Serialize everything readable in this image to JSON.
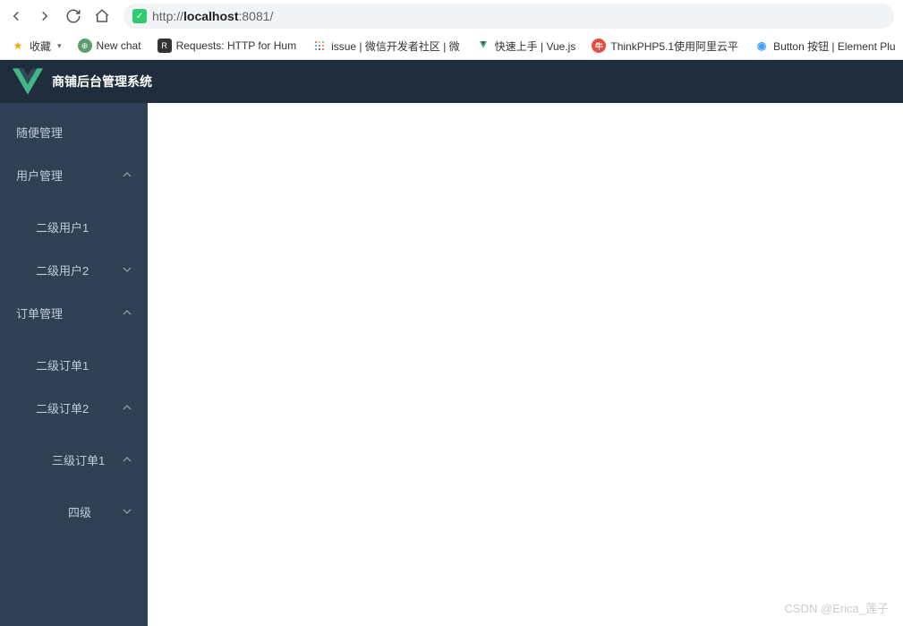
{
  "browser": {
    "url_scheme": "http://",
    "url_host": "localhost",
    "url_port": ":8081",
    "url_path": "/"
  },
  "bookmarks": {
    "favorites": "收藏",
    "newchat": "New chat",
    "requests": "Requests: HTTP for Hum",
    "issue": "issue | 微信开发者社区 | 微",
    "vuejs": "快速上手 | Vue.js",
    "thinkphp": "ThinkPHP5.1使用阿里云平",
    "button": "Button 按钮 | Element Plu"
  },
  "app": {
    "title": "商铺后台管理系统"
  },
  "menu": {
    "item1": "随便管理",
    "item2": "用户管理",
    "item2_1": "二级用户1",
    "item2_2": "二级用户2",
    "item3": "订单管理",
    "item3_1": "二级订单1",
    "item3_2": "二级订单2",
    "item3_2_1": "三级订单1",
    "item3_2_1_1": "四级"
  },
  "watermark": "CSDN @Erica_莲子"
}
